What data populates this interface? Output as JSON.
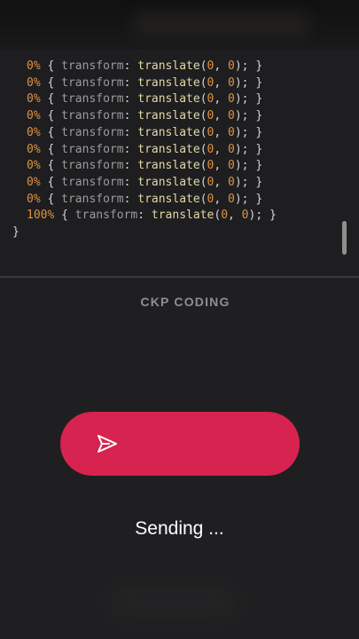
{
  "code": {
    "lines": [
      {
        "pct": "0%",
        "open": " { ",
        "prop": "transform",
        "colon": ": ",
        "func": "translate",
        "lp": "(",
        "a": "0",
        "comma": ", ",
        "b": "0",
        "rp": "); ",
        "close": "}"
      },
      {
        "pct": "0%",
        "open": " { ",
        "prop": "transform",
        "colon": ": ",
        "func": "translate",
        "lp": "(",
        "a": "0",
        "comma": ", ",
        "b": "0",
        "rp": "); ",
        "close": "}"
      },
      {
        "pct": "0%",
        "open": " { ",
        "prop": "transform",
        "colon": ": ",
        "func": "translate",
        "lp": "(",
        "a": "0",
        "comma": ", ",
        "b": "0",
        "rp": "); ",
        "close": "}"
      },
      {
        "pct": "0%",
        "open": " { ",
        "prop": "transform",
        "colon": ": ",
        "func": "translate",
        "lp": "(",
        "a": "0",
        "comma": ", ",
        "b": "0",
        "rp": "); ",
        "close": "}"
      },
      {
        "pct": "0%",
        "open": " { ",
        "prop": "transform",
        "colon": ": ",
        "func": "translate",
        "lp": "(",
        "a": "0",
        "comma": ", ",
        "b": "0",
        "rp": "); ",
        "close": "}"
      },
      {
        "pct": "0%",
        "open": " { ",
        "prop": "transform",
        "colon": ": ",
        "func": "translate",
        "lp": "(",
        "a": "0",
        "comma": ", ",
        "b": "0",
        "rp": "); ",
        "close": "}"
      },
      {
        "pct": "0%",
        "open": " { ",
        "prop": "transform",
        "colon": ": ",
        "func": "translate",
        "lp": "(",
        "a": "0",
        "comma": ", ",
        "b": "0",
        "rp": "); ",
        "close": "}"
      },
      {
        "pct": "0%",
        "open": " { ",
        "prop": "transform",
        "colon": ": ",
        "func": "translate",
        "lp": "(",
        "a": "0",
        "comma": ", ",
        "b": "0",
        "rp": "); ",
        "close": "}"
      },
      {
        "pct": "0%",
        "open": " { ",
        "prop": "transform",
        "colon": ": ",
        "func": "translate",
        "lp": "(",
        "a": "0",
        "comma": ", ",
        "b": "0",
        "rp": "); ",
        "close": "}"
      },
      {
        "pct": "100%",
        "open": " { ",
        "prop": "transform",
        "colon": ": ",
        "func": "translate",
        "lp": "(",
        "a": "0",
        "comma": ", ",
        "b": "0",
        "rp": "); ",
        "close": "}"
      }
    ],
    "closing_brace": "}"
  },
  "brand": {
    "label": "CKP CODING"
  },
  "send_button": {
    "icon": "send-icon",
    "color": "#d7234f"
  },
  "status": {
    "text": "Sending ..."
  }
}
